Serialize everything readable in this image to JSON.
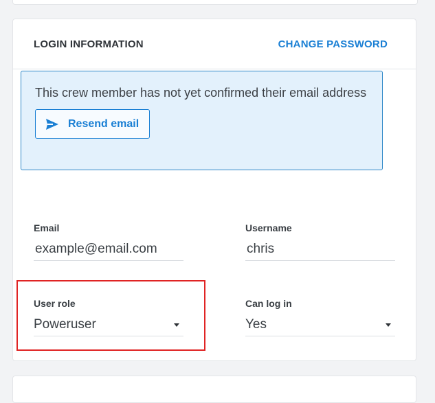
{
  "section": {
    "title": "LOGIN INFORMATION",
    "change_password_label": "CHANGE PASSWORD"
  },
  "notice": {
    "text": "This crew member has not yet confirmed their email address",
    "resend_label": "Resend email",
    "icon": "send-icon"
  },
  "fields": {
    "email": {
      "label": "Email",
      "value": "example@email.com"
    },
    "username": {
      "label": "Username",
      "value": "chris"
    },
    "user_role": {
      "label": "User role",
      "value": "Poweruser"
    },
    "can_log_in": {
      "label": "Can log in",
      "value": "Yes"
    }
  },
  "colors": {
    "accent": "#1a7fd4",
    "notice_bg": "#e3f1fc",
    "notice_border": "#2c86c7",
    "highlight": "#e02424"
  }
}
